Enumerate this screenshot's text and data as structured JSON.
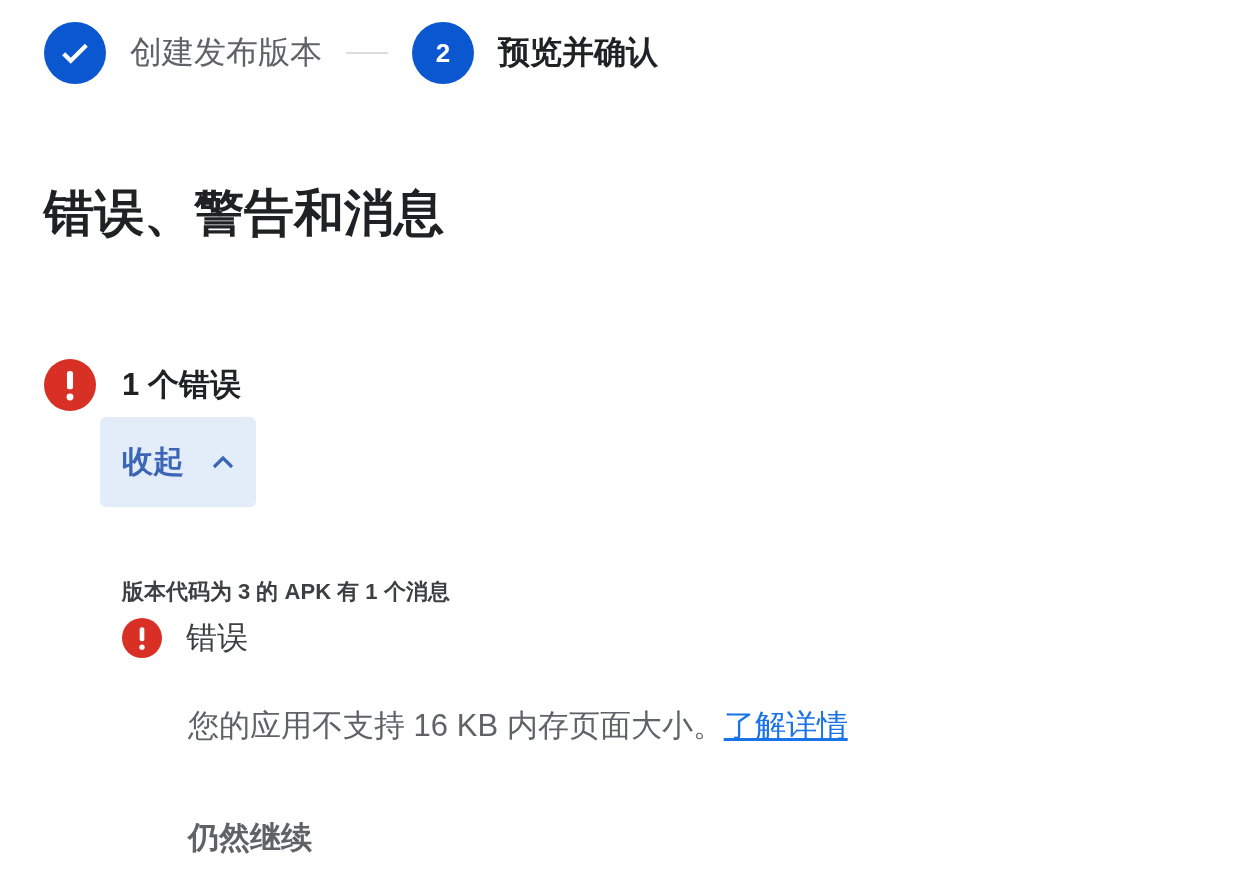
{
  "steps": [
    {
      "label": "创建发布版本",
      "completed": true,
      "selected": false
    },
    {
      "number": "2",
      "label": "预览并确认",
      "completed": false,
      "selected": true
    }
  ],
  "heading": "错误、警告和消息",
  "error_summary": {
    "title": "1 个错误",
    "toggle": {
      "label": "收起",
      "expanded": true
    }
  },
  "apk_group": {
    "title": "版本代码为 3 的 APK 有 1 个消息",
    "messages": [
      {
        "kind": "error",
        "label": "错误",
        "text": "您的应用不支持 16 KB 内存页面大小。",
        "link": "了解详情"
      }
    ]
  },
  "continue_button": "仍然继续"
}
